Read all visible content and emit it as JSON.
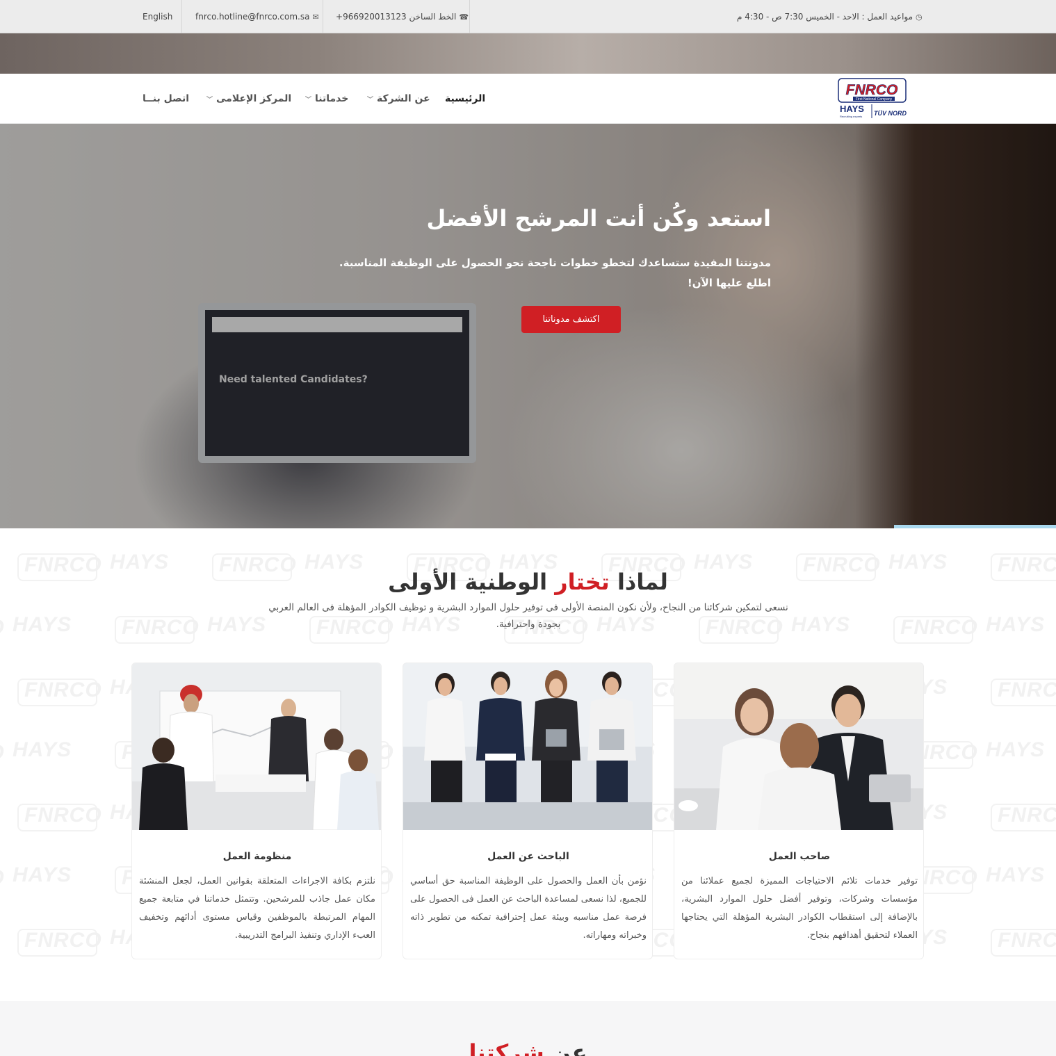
{
  "topbar": {
    "language": "English",
    "email": "fnrco.hotline@fnrco.com.sa",
    "hotline": "الخط الساخن 966920013123+",
    "hours": "مواعيد العمل : الاحد - الخميس 7:30 ص - 4:30 م"
  },
  "logo": {
    "brand": "FNRCO",
    "tagline": "First National Company",
    "partner1": "HAYS",
    "partner1_tagline": "Recruiting experts worldwide",
    "partner2": "TÜV NORD"
  },
  "nav": {
    "items": [
      {
        "label": "الرئيسية",
        "active": true,
        "dropdown": false
      },
      {
        "label": "عن الشركة",
        "active": false,
        "dropdown": true
      },
      {
        "label": "خدماتنا",
        "active": false,
        "dropdown": true
      },
      {
        "label": "المركز الإعلامى",
        "active": false,
        "dropdown": true
      },
      {
        "label": "اتصل بنــا",
        "active": false,
        "dropdown": false
      }
    ]
  },
  "hero": {
    "title": "استعد وكُن أنت المرشح الأفضل",
    "text_line1": "مدونتنا المفيدة ستساعدك لتخطو خطوات ناجحة نحو الحصول على الوظيفة المناسبة.",
    "text_line2": "اطلع عليها الآن!",
    "button": "اكتشف مدوناتنا",
    "laptop_text": "Need talented Candidates?"
  },
  "why": {
    "title_part1": "لماذا",
    "title_red": "تختار",
    "title_part2": "الوطنية الأولى",
    "text": "نسعى لتمكين شركائنا من النجاح، ولأن نكون المنصة الأولى فى توفير حلول الموارد البشرية و توظيف الكوادر المؤهلة فى العالم العربي بجودة واحترافية.",
    "cards": [
      {
        "title": "صاحب العمل",
        "text": "توفير خدمات تلائم الاحتياجات المميزة لجميع عملائنا من مؤسسات وشركات، وتوفير أفضل حلول الموارد البشرية، بالإضافة إلى استقطاب الكوادر البشرية المؤهلة التي يحتاجها العملاء لتحقيق أهدافهم بنجاح."
      },
      {
        "title": "الباحث عن العمل",
        "text": "نؤمن بأن العمل والحصول على الوظيفة المناسبة حق أساسي للجميع، لذا نسعى لمساعدة الباحث عن العمل فى الحصول على فرصة عمل مناسبه وبيئة عمل إحترافية تمكنه من تطوير ذاته وخبراته ومهاراته."
      },
      {
        "title": "منظومة العمل",
        "text": "نلتزم بكافة الاجراءات المتعلقة بقوانين العمل، لجعل المنشئة مكان عمل جاذب للمرشحين. وتتمثل خدماتنا في متابعة جميع المهام المرتبطة بالموظفين وقياس مستوى أدائهم وتخفيف العبء الإداري وتنفيذ البرامج التدريبية."
      }
    ]
  },
  "next_section": {
    "title_part1": "عن",
    "title_red": "شركتنا"
  },
  "colors": {
    "accent": "#d01f24",
    "topbar_bg": "#ececec",
    "section_bg": "#f6f6f7"
  }
}
